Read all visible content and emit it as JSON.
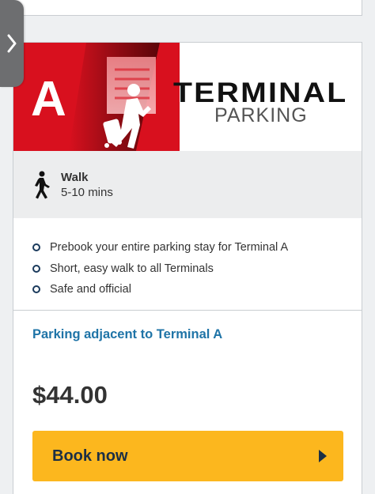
{
  "banner": {
    "letter": "A",
    "brand_title": "TERMINAL",
    "brand_subtitle": "PARKING",
    "colors": {
      "red": "#d8101e",
      "dark_red": "#8e0a12"
    }
  },
  "walk": {
    "label": "Walk",
    "duration": "5-10 mins",
    "icon": "walking-person-icon"
  },
  "features": [
    "Prebook your entire parking stay for Terminal A",
    "Short, easy walk to all Terminals",
    "Safe and official"
  ],
  "description": "Parking adjacent to Terminal A",
  "price": "$44.00",
  "book_button": {
    "label": "Book now",
    "icon": "play-arrow-icon",
    "color": "#fcb71e"
  },
  "side_tab": {
    "icon": "chevron-right-icon"
  }
}
